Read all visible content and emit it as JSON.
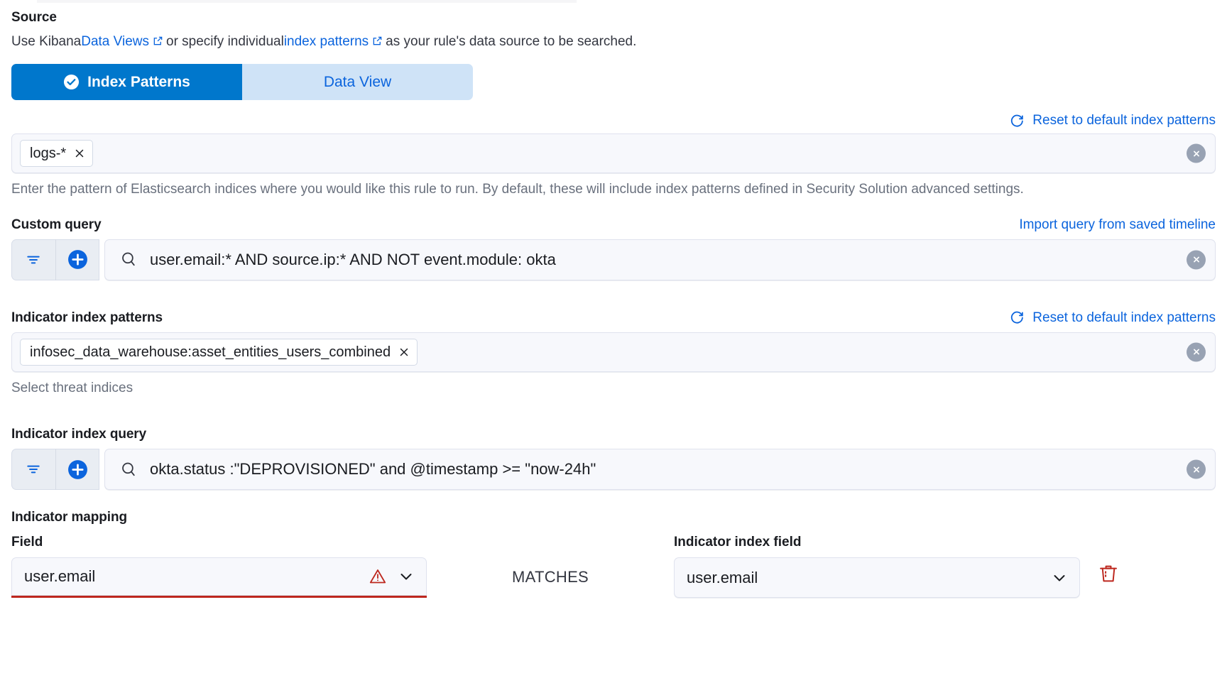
{
  "source": {
    "title": "Source",
    "description_prefix": "Use Kibana ",
    "link_data_views": "Data Views",
    "description_middle": " or specify individual ",
    "link_index_patterns": "index patterns",
    "description_suffix": " as your rule's data source to be searched.",
    "tabs": [
      {
        "label": "Index Patterns",
        "selected": true,
        "icon": "check-circle-icon"
      },
      {
        "label": "Data View",
        "selected": false
      }
    ]
  },
  "index_patterns": {
    "reset_link": "Reset to default index patterns",
    "pills": [
      "logs-*"
    ],
    "hint": "Enter the pattern of Elasticsearch indices where you would like this rule to run. By default, these will include index patterns defined in Security Solution advanced settings."
  },
  "custom_query": {
    "label": "Custom query",
    "import_link": "Import query from saved timeline",
    "value": "user.email:* AND source.ip:* AND NOT event.module: okta"
  },
  "indicator_index_patterns": {
    "label": "Indicator index patterns",
    "reset_link": "Reset to default index patterns",
    "pills": [
      "infosec_data_warehouse:asset_entities_users_combined"
    ],
    "hint": "Select threat indices"
  },
  "indicator_index_query": {
    "label": "Indicator index query",
    "value": "okta.status :\"DEPROVISIONED\" and @timestamp >= \"now-24h\""
  },
  "indicator_mapping": {
    "title": "Indicator mapping",
    "field_label": "Field",
    "field_value": "user.email",
    "field_invalid": true,
    "operator": "MATCHES",
    "indicator_field_label": "Indicator index field",
    "indicator_field_value": "user.email"
  },
  "colors": {
    "accent_blue": "#0077cc",
    "link_blue": "#0b64dd",
    "tab_inactive_bg": "#cfe3f7",
    "danger_red": "#bd271e",
    "muted_text": "#69707d",
    "field_bg": "#f7f8fc"
  }
}
